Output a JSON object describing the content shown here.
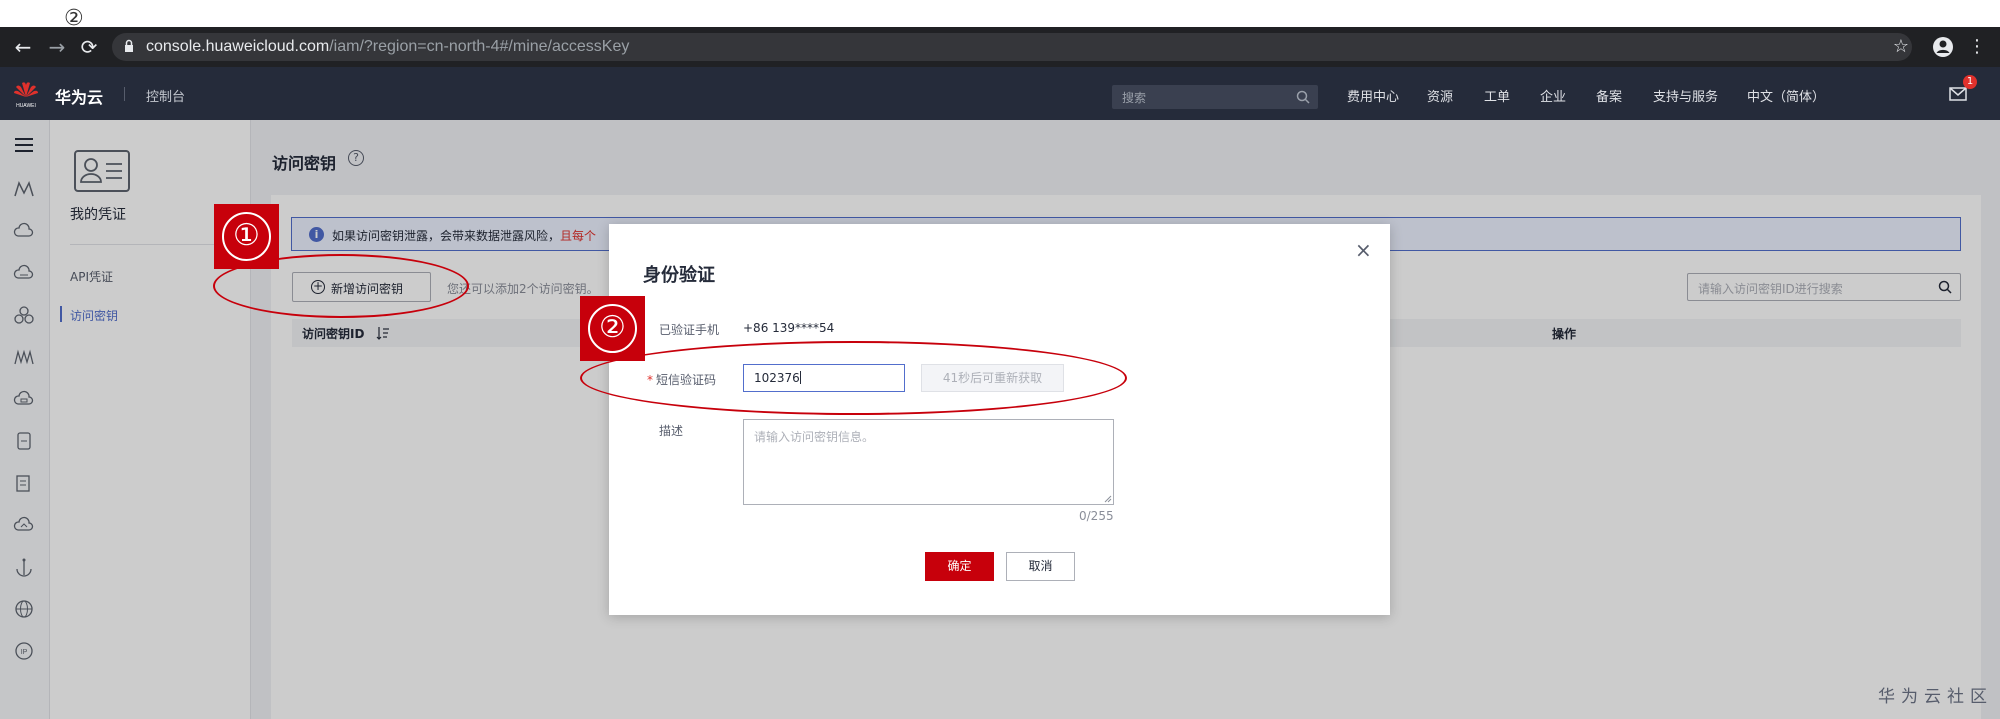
{
  "top_strip": {
    "symbol": "②"
  },
  "browser": {
    "back": "←",
    "forward": "→",
    "reload": "⟳",
    "url_host": "console.huaweicloud.com",
    "url_path": "/iam/?region=cn-north-4#/mine/accessKey",
    "star": "☆",
    "menu": "⋮"
  },
  "header": {
    "logo_text": "HUAWEI",
    "brand": "华为云",
    "console": "控制台",
    "search_placeholder": "搜索",
    "nav": [
      "费用中心",
      "资源",
      "工单",
      "企业",
      "备案",
      "支持与服务",
      "中文（简体）"
    ],
    "mail_badge": "1"
  },
  "sidebar": {
    "title": "我的凭证",
    "items": [
      "API凭证",
      "访问密钥"
    ],
    "active": "访问密钥"
  },
  "main": {
    "title": "访问密钥",
    "alert_text": "如果访问密钥泄露，会带来数据泄露风险，",
    "alert_red": "且每个",
    "add_button": "新增访问密钥",
    "hint": "您还可以添加2个访问密钥。",
    "search_placeholder": "请输入访问密钥ID进行搜索",
    "columns": [
      "访问密钥ID",
      "操作"
    ]
  },
  "modal": {
    "title": "身份验证",
    "close": "×",
    "phone_label": "已验证手机",
    "phone_value": "+86 139****54",
    "code_label": "短信验证码",
    "code_required": "*",
    "code_value": "102376",
    "resend": "41秒后可重新获取",
    "desc_label": "描述",
    "desc_placeholder": "请输入访问密钥信息。",
    "counter": "0/255",
    "ok": "确定",
    "cancel": "取消"
  },
  "annotations": [
    "①",
    "②"
  ],
  "watermark": "华为云社区",
  "colors": {
    "accent_red": "#c7000b",
    "link_blue": "#526ecc",
    "header_bg": "#252b3a"
  }
}
